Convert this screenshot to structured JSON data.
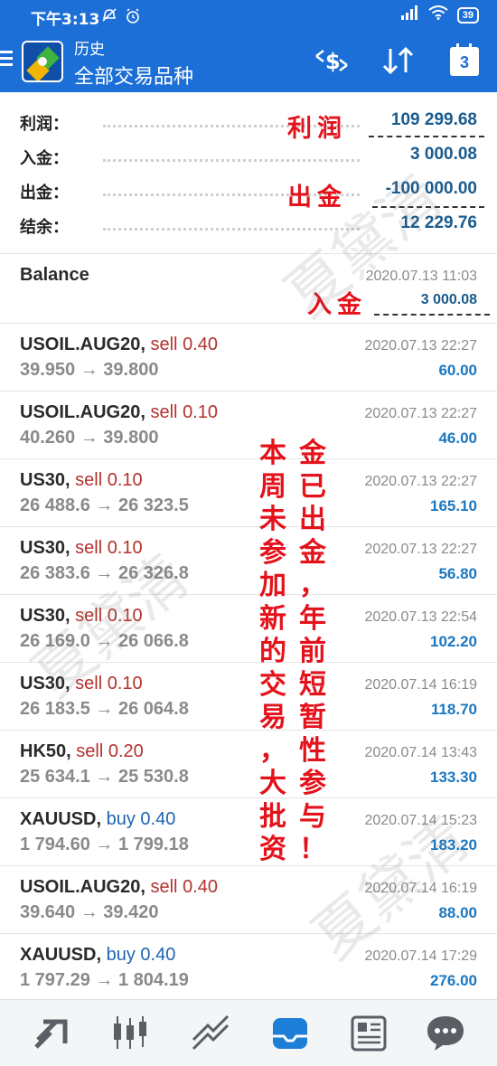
{
  "status_bar": {
    "time": "下午3:13",
    "battery": "39"
  },
  "app_bar": {
    "subtitle": "历史",
    "title": "全部交易品种",
    "calendar_day": "3"
  },
  "summary": [
    {
      "label": "利润：",
      "value": "109 299.68"
    },
    {
      "label": "入金：",
      "value": "3 000.08"
    },
    {
      "label": "出金：",
      "value": "-100 000.00"
    },
    {
      "label": "结余：",
      "value": "12 229.76"
    }
  ],
  "balance": {
    "label": "Balance",
    "date": "2020.07.13 11:03",
    "value": "3 000.08"
  },
  "trades": [
    {
      "symbol": "USOIL.AUG20,",
      "direction": "sell",
      "volume": "0.40",
      "prices": "39.950 → 39.800",
      "date": "2020.07.13 22:27",
      "profit": "60.00"
    },
    {
      "symbol": "USOIL.AUG20,",
      "direction": "sell",
      "volume": "0.10",
      "prices": "40.260 → 39.800",
      "date": "2020.07.13 22:27",
      "profit": "46.00"
    },
    {
      "symbol": "US30,",
      "direction": "sell",
      "volume": "0.10",
      "prices": "26 488.6 → 26 323.5",
      "date": "2020.07.13 22:27",
      "profit": "165.10"
    },
    {
      "symbol": "US30,",
      "direction": "sell",
      "volume": "0.10",
      "prices": "26 383.6 → 26 326.8",
      "date": "2020.07.13 22:27",
      "profit": "56.80"
    },
    {
      "symbol": "US30,",
      "direction": "sell",
      "volume": "0.10",
      "prices": "26 169.0 → 26 066.8",
      "date": "2020.07.13 22:54",
      "profit": "102.20"
    },
    {
      "symbol": "US30,",
      "direction": "sell",
      "volume": "0.10",
      "prices": "26 183.5 → 26 064.8",
      "date": "2020.07.14 16:19",
      "profit": "118.70"
    },
    {
      "symbol": "HK50,",
      "direction": "sell",
      "volume": "0.20",
      "prices": "25 634.1 → 25 530.8",
      "date": "2020.07.14 13:43",
      "profit": "133.30"
    },
    {
      "symbol": "XAUUSD,",
      "direction": "buy",
      "volume": "0.40",
      "prices": "1 794.60 → 1 799.18",
      "date": "2020.07.14 15:23",
      "profit": "183.20"
    },
    {
      "symbol": "USOIL.AUG20,",
      "direction": "sell",
      "volume": "0.40",
      "prices": "39.640 → 39.420",
      "date": "2020.07.14 16:19",
      "profit": "88.00"
    },
    {
      "symbol": "XAUUSD,",
      "direction": "buy",
      "volume": "0.40",
      "prices": "1 797.29 → 1 804.19",
      "date": "2020.07.14 17:29",
      "profit": "276.00"
    }
  ],
  "annotations": {
    "profit": "利润",
    "withdrawal": "出金",
    "deposit": "入金",
    "col1": [
      "本",
      "周",
      "未",
      "参",
      "加",
      "新",
      "的",
      "交",
      "易",
      "，",
      "大",
      "批",
      "资"
    ],
    "col2": [
      "金",
      "已",
      "出",
      "金",
      "，",
      "年",
      "前",
      "短",
      "暂",
      "性",
      "参",
      "与",
      "！"
    ]
  },
  "watermark": "夏黛清",
  "colors": {
    "primary": "#1c6fd6",
    "sell": "#b3322d",
    "buy": "#1f64b4",
    "profit": "#1a78c2",
    "annotation": "#e4121b"
  },
  "bottom_nav": [
    "quotes-icon",
    "chart-icon",
    "trade-icon",
    "history-icon",
    "news-icon",
    "messages-icon"
  ]
}
